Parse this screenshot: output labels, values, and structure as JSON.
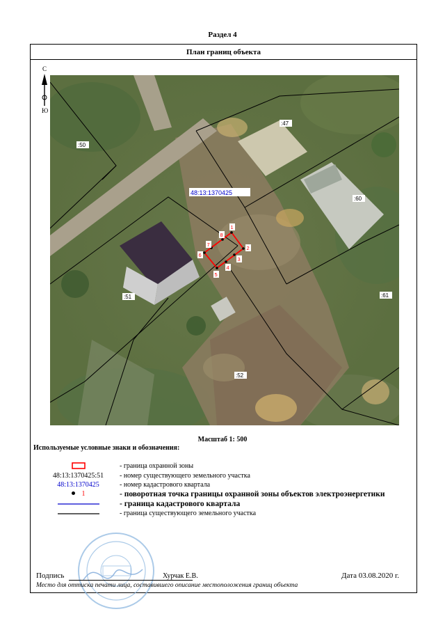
{
  "section": "Раздел 4",
  "header": {
    "title": "План границ объекта"
  },
  "compass": {
    "north": "С",
    "south": "Ю"
  },
  "map": {
    "cadastral_block": "48:13:1370425",
    "parcel_labels": [
      ":50",
      ":47",
      ":60",
      ":51",
      ":61",
      ":52"
    ],
    "points": [
      "1",
      "2",
      "3",
      "4",
      "5",
      "6",
      "7",
      "8"
    ]
  },
  "scale": "Масштаб 1: 500",
  "legend": {
    "title": "Используемые условные знаки и обозначения:",
    "items": [
      {
        "symbol": "",
        "desc": "- граница  охранной зоны"
      },
      {
        "symbol": "48:13:1370425:51",
        "desc": "- номер существующего земельного участка"
      },
      {
        "symbol": "48:13:1370425",
        "desc": "- номер кадастрового квартала"
      },
      {
        "symbol": "1",
        "desc": "- поворотная точка границы охранной зоны объектов электроэнергетики"
      },
      {
        "symbol": "",
        "desc": "- граница кадастрового квартала"
      },
      {
        "symbol": "",
        "desc": "- граница существующего земельного участка"
      }
    ],
    "colors": {
      "zone": "#ff0000",
      "block_text": "#0000cc",
      "block_line": "#0000cc",
      "parcel_line": "#000000"
    }
  },
  "signature": {
    "label": "Подпись",
    "name": "Хурчак Е.В.",
    "date": "Дата 03.08.2020 г.",
    "note": "Место для оттиска печати лица, составившего описание местоположения границ объекта"
  }
}
